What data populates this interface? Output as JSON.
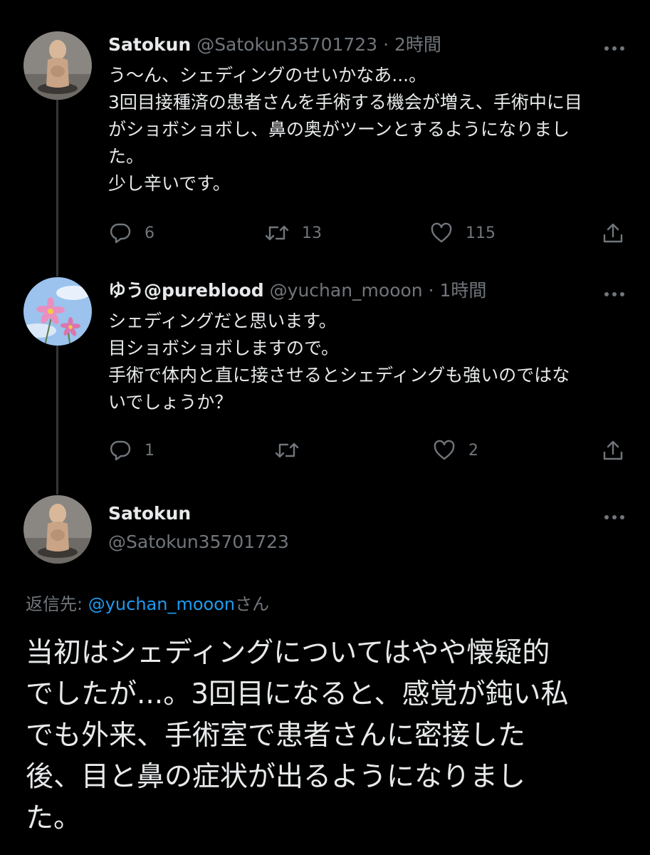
{
  "tweet1": {
    "display_name": "Satokun",
    "handle": "@Satokun35701723",
    "separator": "·",
    "time": "2時間",
    "text": "う〜ん、シェディングのせいかなあ...。\n3回目接種済の患者さんを手術する機会が増え、手術中に目\nがショボショボし、鼻の奥がツーンとするようになりまし\nた。\n少し辛いです。",
    "reply_count": "6",
    "retweet_count": "13",
    "like_count": "115"
  },
  "tweet2": {
    "display_name": "ゆう@pureblood",
    "handle": "@yuchan_mooon",
    "separator": "·",
    "time": "1時間",
    "text": "シェディングだと思います。\n目ショボショボしますので。\n手術で体内と直に接させるとシェディングも強いのではな\nいでしょうか？",
    "reply_count": "1",
    "retweet_count": "",
    "like_count": "2"
  },
  "main_tweet": {
    "display_name": "Satokun",
    "handle": "@Satokun35701723",
    "reply_to_prefix": "返信先: ",
    "reply_to_handle": "@yuchan_mooon",
    "reply_to_suffix": "さん",
    "text": "当初はシェディングについてはやや懐疑的\nでしたが...。3回目になると、感覚が鈍い私\nでも外来、手術室で患者さんに密接した\n後、目と鼻の症状が出るようになりまし\nた。"
  },
  "colors": {
    "background": "#000000",
    "text": "#e7e9ea",
    "secondary": "#71767b",
    "accent": "#1d9bf0",
    "thread_line": "#333639"
  },
  "icons": [
    "more-icon",
    "reply-icon",
    "retweet-icon",
    "like-icon",
    "share-icon"
  ]
}
